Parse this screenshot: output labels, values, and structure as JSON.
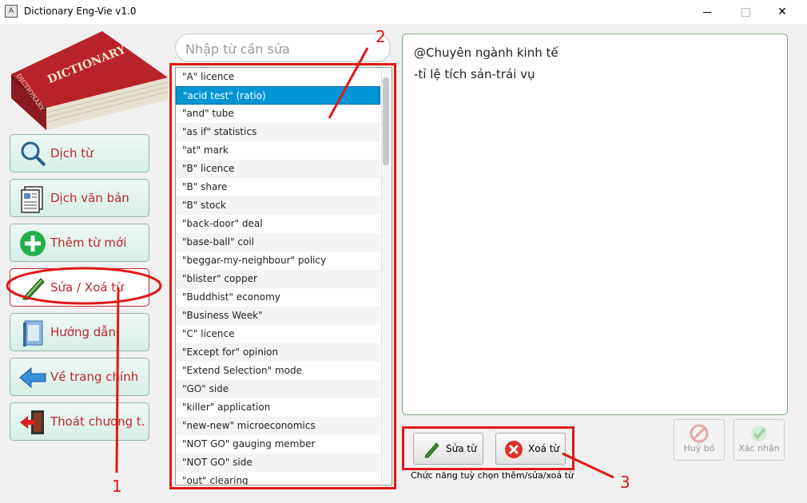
{
  "window": {
    "title": "Dictionary Eng-Vie v1.0",
    "icon": "dictionary-app-icon"
  },
  "logo": {
    "text_top": "DICTIONARY",
    "text_spine": "DICTIONARY"
  },
  "nav": [
    {
      "label": "Dịch từ",
      "icon": "magnifier-icon"
    },
    {
      "label": "Dịch văn bản",
      "icon": "document-icon"
    },
    {
      "label": "Thêm từ mới",
      "icon": "plus-icon"
    },
    {
      "label": "Sửa / Xoá từ",
      "icon": "pen-icon",
      "active": true
    },
    {
      "label": "Hướng dẫn",
      "icon": "book-icon"
    },
    {
      "label": "Về trang chính",
      "icon": "arrow-left-icon"
    },
    {
      "label": "Thoát chương t...",
      "icon": "exit-door-icon"
    }
  ],
  "search": {
    "placeholder": "Nhập từ cần sửa",
    "value": ""
  },
  "words": [
    "\"A\" licence",
    "\"acid test\" (ratio)",
    "\"and\" tube",
    "\"as if\" statistics",
    "\"at\" mark",
    "\"B\" licence",
    "\"B\" share",
    "\"B\" stock",
    "\"back-door\" deal",
    "\"base-ball\" coil",
    "\"beggar-my-neighbour\" policy",
    "\"blister\" copper",
    "\"Buddhist\" economy",
    "\"Business Week\"",
    "\"C\" licence",
    "\"Except for\" opinion",
    "\"Extend Selection\" mode",
    "\"GO\" side",
    "\"killer\" application",
    "\"new-new\" microeconomics",
    "\"NOT GO\" gauging member",
    "\"NOT GO\" side",
    "\"out\" clearing"
  ],
  "selected_index": 1,
  "meaning": {
    "line1": "@Chuyên ngành kinh tế",
    "line2": "-tỉ lệ tích sản-trái vụ"
  },
  "actions": {
    "edit_label": "Sửa từ",
    "delete_label": "Xoá từ",
    "hint": "Chức năng tuỳ chọn thêm/sửa/xoá từ"
  },
  "confirm": {
    "cancel_label": "Huỷ bỏ",
    "confirm_label": "Xác nhận"
  },
  "annotations": {
    "n1": "1",
    "n2": "2",
    "n3": "3"
  },
  "colors": {
    "nav_text": "#c0262c",
    "selection": "#0096d6",
    "annotation": "#e01818"
  }
}
